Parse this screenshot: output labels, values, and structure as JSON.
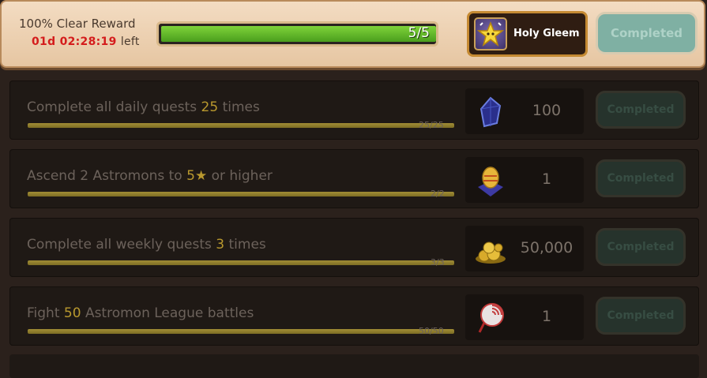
{
  "header": {
    "title": "100% Clear Reward",
    "timer": "01d 02:28:19",
    "timer_suffix": "left",
    "progress_text": "5/5",
    "progress_fraction": 1.0,
    "reward_name": "Holy Gleem",
    "completed_label": "Completed"
  },
  "quests": [
    {
      "pre": "Complete all daily quests ",
      "hl": "25",
      "post": " times",
      "progress": "25/25",
      "fraction": 1.0,
      "reward_icon": "crystal-icon",
      "reward_amount": "100",
      "completed_label": "Completed"
    },
    {
      "pre": "Ascend 2 Astromons to ",
      "hl": "5★",
      "post": " or higher",
      "progress": "2/2",
      "fraction": 1.0,
      "reward_icon": "egg-icon",
      "reward_amount": "1",
      "completed_label": "Completed"
    },
    {
      "pre": "Complete all weekly quests ",
      "hl": "3",
      "post": " times",
      "progress": "3/3",
      "fraction": 1.0,
      "reward_icon": "gold-icon",
      "reward_amount": "50,000",
      "completed_label": "Completed"
    },
    {
      "pre": "Fight ",
      "hl": "50",
      "post": " Astromon League battles",
      "progress": "50/50",
      "fraction": 1.0,
      "reward_icon": "candy-icon",
      "reward_amount": "1",
      "completed_label": "Completed"
    }
  ],
  "colors": {
    "timer": "#d41c1c",
    "highlight": "#b8982e",
    "progress_green": "#5fb82a",
    "row_progress": "#8f7d2c"
  }
}
